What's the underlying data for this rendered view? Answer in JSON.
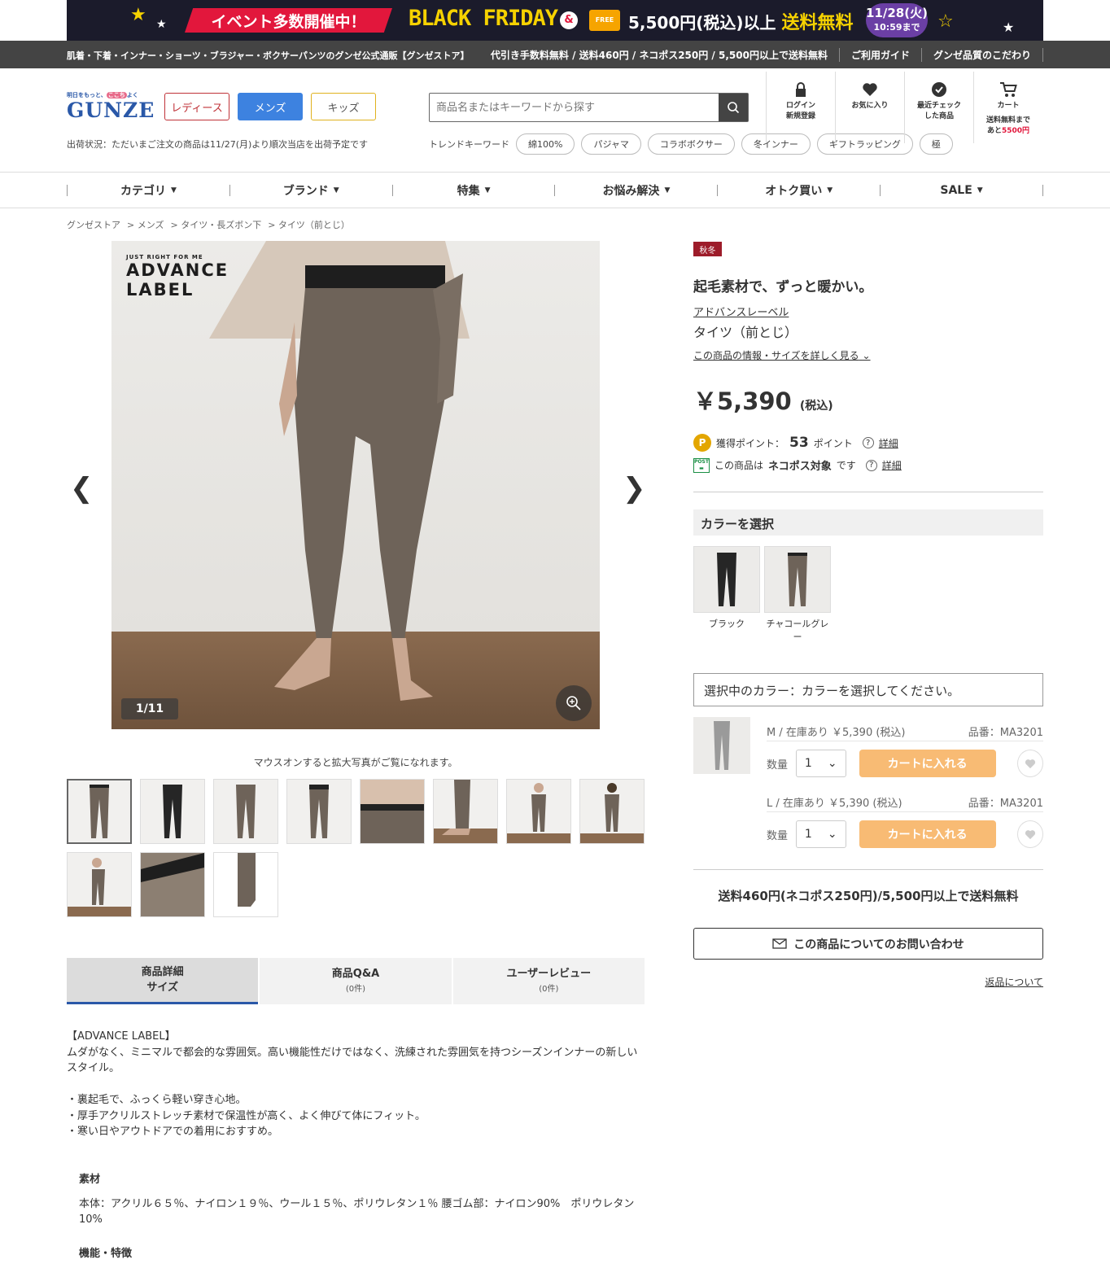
{
  "banner": {
    "event_text": "イベント多数開催中！",
    "black_friday": "BLACK FRIDAY",
    "amp": "&",
    "free_badge": "FREE",
    "shipping_prefix": "5,500円(税込)以上",
    "shipping_highlight": "送料無料",
    "date": "11/28(火)",
    "until": "10:59まで"
  },
  "topbar": {
    "tagline": "肌着・下着・インナー・ショーツ・ブラジャー・ボクサーパンツのグンゼ公式通販【グンゼストア】",
    "links": [
      "代引き手数料無料 / 送料460円 / ネコポス250円 / 5,500円以上で送料無料",
      "ご利用ガイド",
      "グンゼ品質のこだわり"
    ]
  },
  "header": {
    "logo_tag_pre": "明日をもっと、",
    "logo_tag_em": "ここち",
    "logo_tag_post": "よく",
    "logo_word": "GUNZE",
    "gender_buttons": [
      "レディース",
      "メンズ",
      "キッズ"
    ],
    "shipping_status": "出荷状況：ただいまご注文の商品は11/27(月)より順次当店を出荷予定です",
    "search_placeholder": "商品名またはキーワードから探す",
    "trend_label": "トレンドキーワード",
    "trend_keywords": [
      "綿100%",
      "パジャマ",
      "コラボボクサー",
      "冬インナー",
      "ギフトラッピング",
      "極"
    ],
    "icons": {
      "login_1": "ログイン",
      "login_2": "新規登録",
      "favorite": "お気に入り",
      "recent_1": "最近チェック",
      "recent_2": "した商品",
      "cart": "カート",
      "cart_note_1": "送料無料まで",
      "cart_note_2": "あと",
      "cart_note_amount": "5500円"
    }
  },
  "nav": [
    "カテゴリ",
    "ブランド",
    "特集",
    "お悩み解決",
    "オトク買い",
    "SALE"
  ],
  "breadcrumb": [
    "グンゼストア",
    "> メンズ",
    "> タイツ・長ズボン下",
    "> タイツ（前とじ）"
  ],
  "gallery": {
    "brand_small": "JUST RIGHT FOR ME",
    "brand_1": "ADVANCE",
    "brand_2": "LABEL",
    "counter": "1/11",
    "hint": "マウスオンすると拡大写真がご覧になれます。"
  },
  "tabs": [
    {
      "label": "商品詳細",
      "sub": "サイズ"
    },
    {
      "label": "商品Q&A",
      "sub": "(0件)"
    },
    {
      "label": "ユーザーレビュー",
      "sub": "(0件)"
    }
  ],
  "description": {
    "heading": "【ADVANCE LABEL】",
    "body": "ムダがなく、ミニマルで都会的な雰囲気。高い機能性だけではなく、洗練された雰囲気を持つシーズンインナーの新しいスタイル。",
    "bullets": [
      "・裏起毛で、ふっくら軽い穿き心地。",
      "・厚手アクリルストレッチ素材で保温性が高く、よく伸びて体にフィット。",
      "・寒い日やアウトドアでの着用におすすめ。"
    ],
    "material_title": "素材",
    "material_text": "本体：アクリル６５％、ナイロン１９％、ウール１５％、ポリウレタン１％ 腰ゴム部：ナイロン90%　ポリウレタン10%",
    "feature_title": "機能・特徴"
  },
  "product": {
    "season": "秋冬",
    "catch": "起毛素材で、ずっと暖かい。",
    "brand": "アドバンスレーベル",
    "name": "タイツ（前とじ）",
    "more_link": "この商品の情報・サイズを詳しく見る",
    "price": "￥5,390",
    "tax": "(税込)",
    "points_label": "獲得ポイント：",
    "points_value": "53",
    "points_unit": "ポイント",
    "detail": "詳細",
    "post_pre": "この商品は",
    "post_bold": "ネコポス対象",
    "post_post": "です",
    "color_head": "カラーを選択",
    "colors": [
      "ブラック",
      "チャコールグレー"
    ],
    "selected_color": "選択中のカラー：カラーを選択してください。",
    "skus": [
      {
        "size": "M / 在庫あり ￥5,390 (税込)",
        "code": "品番：MA3201",
        "qty_label": "数量",
        "qty": "1",
        "cart": "カートに入れる"
      },
      {
        "size": "L / 在庫あり ￥5,390 (税込)",
        "code": "品番：MA3201",
        "qty_label": "数量",
        "qty": "1",
        "cart": "カートに入れる"
      }
    ],
    "shipping_note": "送料460円(ネコポス250円)/5,500円以上で送料無料",
    "inquiry": "この商品についてのお問い合わせ",
    "returns": "返品について"
  },
  "colors": {
    "accent_blue": "#3d82e0",
    "cart_orange": "#f8bb74",
    "season_red": "#9d1c2a"
  }
}
